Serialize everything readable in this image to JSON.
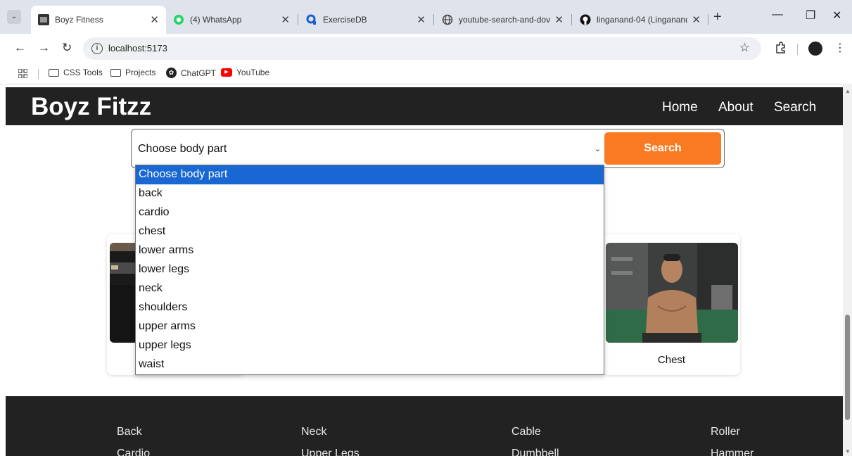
{
  "browser": {
    "tabs": [
      {
        "title": "Boyz Fitness",
        "favicon": "site-favicon",
        "active": true
      },
      {
        "title": "(4) WhatsApp",
        "favicon": "whatsapp-icon",
        "active": false
      },
      {
        "title": "ExerciseDB",
        "favicon": "exercisedb-icon",
        "active": false
      },
      {
        "title": "youtube-search-and-dov",
        "favicon": "globe-icon",
        "active": false
      },
      {
        "title": "linganand-04 (Linganand",
        "favicon": "github-icon",
        "active": false
      }
    ],
    "url": "localhost:5173",
    "bookmarks": [
      {
        "label": "CSS Tools",
        "icon": "folder-icon"
      },
      {
        "label": "Projects",
        "icon": "folder-icon"
      },
      {
        "label": "ChatGPT",
        "icon": "chatgpt-icon"
      },
      {
        "label": "YouTube",
        "icon": "youtube-icon"
      }
    ],
    "colors": {
      "tabstrip": "#dfe3eb",
      "omnibox": "#eef0f4",
      "selected_option": "#1967d2"
    }
  },
  "site": {
    "logo": "Boyz Fitzz",
    "nav": [
      "Home",
      "About",
      "Search"
    ],
    "accent": "#f97a23",
    "header_bg": "#222222"
  },
  "search": {
    "selected": "Choose body part",
    "button": "Search",
    "options": [
      "Choose body part",
      "back",
      "cardio",
      "chest",
      "lower arms",
      "lower legs",
      "neck",
      "shoulders",
      "upper arms",
      "upper legs",
      "waist"
    ],
    "highlighted_index": 0
  },
  "cards": [
    {
      "label": ""
    },
    {
      "label": "Chest"
    }
  ],
  "footer": {
    "columns": [
      [
        "Back",
        "Cardio"
      ],
      [
        "Neck",
        "Upper Legs"
      ],
      [
        "Cable",
        "Dumbbell"
      ],
      [
        "Roller",
        "Hammer"
      ]
    ]
  }
}
